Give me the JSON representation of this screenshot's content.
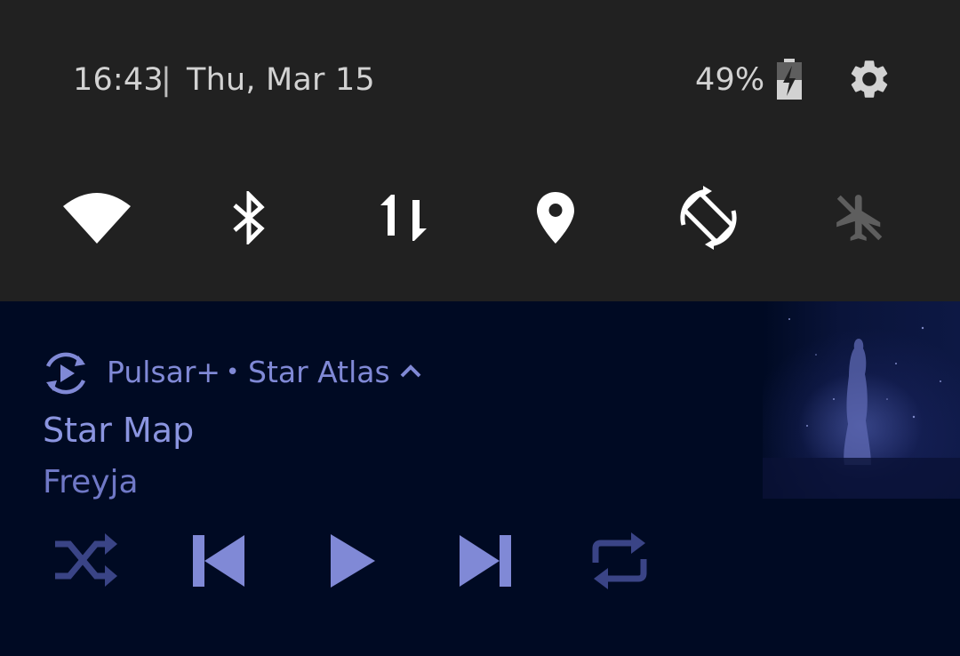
{
  "status_bar": {
    "time": "16:43",
    "separator": "|",
    "date": "Thu, Mar 15",
    "battery_percent": "49%",
    "battery_icon": "battery-charging-icon",
    "settings_icon": "gear-icon"
  },
  "quick_settings": {
    "tiles": [
      {
        "icon": "wifi-icon",
        "state": "on"
      },
      {
        "icon": "bluetooth-icon",
        "state": "on"
      },
      {
        "icon": "mobile-data-icon",
        "state": "on"
      },
      {
        "icon": "location-icon",
        "state": "on"
      },
      {
        "icon": "auto-rotate-icon",
        "state": "on"
      },
      {
        "icon": "airplane-mode-icon",
        "state": "off"
      }
    ]
  },
  "media_notification": {
    "app_name": "Pulsar+",
    "dot": "•",
    "album": "Star Atlas",
    "title": "Star Map",
    "artist": "Freyja",
    "controls": [
      {
        "icon": "shuffle-icon",
        "state": "off"
      },
      {
        "icon": "skip-previous-icon"
      },
      {
        "icon": "play-icon"
      },
      {
        "icon": "skip-next-icon"
      },
      {
        "icon": "repeat-icon",
        "state": "off"
      }
    ]
  },
  "colors": {
    "panel_background": "#212121",
    "media_background": "#000a23",
    "media_accent": "#8b95e0",
    "icon_on": "#ffffff",
    "icon_off": "#5e5e5e"
  }
}
